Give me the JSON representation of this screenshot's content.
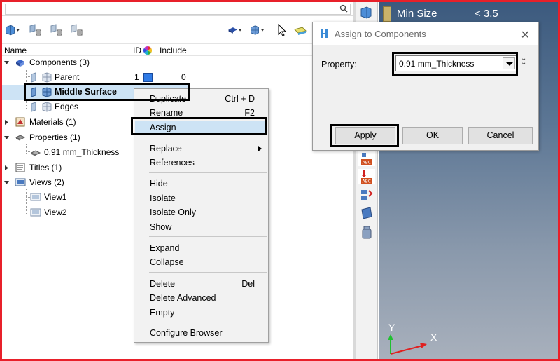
{
  "browser": {
    "columns": {
      "name": "Name",
      "id": "ID",
      "include": "Include"
    },
    "tree": {
      "components": "Components (3)",
      "parent": {
        "label": "Parent",
        "id": "1",
        "include": "0"
      },
      "middle_surface": {
        "label": "Middle Surface"
      },
      "edges": {
        "label": "Edges"
      },
      "materials": "Materials (1)",
      "properties": "Properties (1)",
      "property_item": "0.91 mm_Thickness",
      "titles": "Titles (1)",
      "views": "Views (2)",
      "view1": "View1",
      "view2": "View2"
    }
  },
  "context_menu": {
    "items": [
      {
        "label": "Duplicate",
        "shortcut": "Ctrl + D"
      },
      {
        "label": "Rename",
        "shortcut": "F2"
      },
      {
        "label": "Assign"
      },
      {
        "label": "Replace"
      },
      {
        "label": "References"
      },
      {
        "label": "Hide"
      },
      {
        "label": "Isolate"
      },
      {
        "label": "Isolate Only"
      },
      {
        "label": "Show"
      },
      {
        "label": "Expand"
      },
      {
        "label": "Collapse"
      },
      {
        "label": "Delete",
        "shortcut": "Del"
      },
      {
        "label": "Delete Advanced"
      },
      {
        "label": "Empty"
      },
      {
        "label": "Configure Browser"
      }
    ]
  },
  "dialog": {
    "title": "Assign to Components",
    "property_label": "Property:",
    "property_value": "0.91 mm_Thickness",
    "apply": "Apply",
    "ok": "OK",
    "cancel": "Cancel"
  },
  "graphics": {
    "legend_label": "Min Size",
    "legend_value": "< 3.5",
    "axis_y": "Y",
    "axis_x": "X"
  },
  "colors": {
    "highlight": "#cde3f5",
    "frame": "#e8202a",
    "id_swatch": "#2f7be6"
  }
}
